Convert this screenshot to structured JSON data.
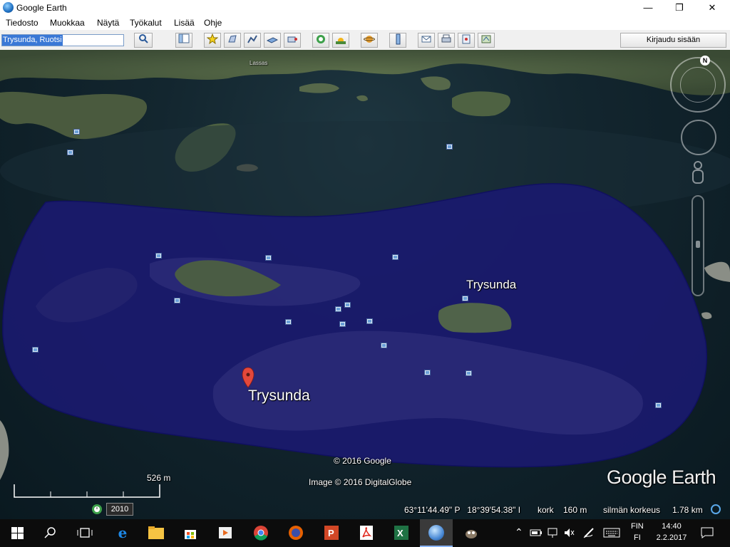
{
  "window": {
    "title": "Google Earth",
    "controls": [
      "—",
      "❐",
      "✕"
    ]
  },
  "menu": [
    "Tiedosto",
    "Muokkaa",
    "Näytä",
    "Työkalut",
    "Lisää",
    "Ohje"
  ],
  "toolbar": {
    "search_value": "Trysunda, Ruotsi",
    "login_label": "Kirjaudu sisään",
    "icons": [
      "search-icon",
      "sidebar-icon",
      "placemark-icon",
      "polygon-icon",
      "path-icon",
      "overlay-icon",
      "record-tour-icon",
      "historical-imagery-icon",
      "sunlight-icon",
      "planets-icon",
      "ruler-icon",
      "email-icon",
      "print-icon",
      "save-image-icon",
      "view-in-maps-icon"
    ]
  },
  "map": {
    "labels": {
      "top_place": "Lassas",
      "island_label": "Trysunda",
      "pin_label": "Trysunda",
      "copyright_google": "© 2016 Google",
      "copyright_image": "Image © 2016 DigitalGlobe",
      "logo": "Google Earth"
    },
    "compass_letter": "N",
    "scale": "526 m",
    "historical_year": "2010",
    "status": {
      "coords": "63°11'44.49\" P   18°39'54.38\" I",
      "elevation_label": "kork",
      "elevation_value": "160 m",
      "eye_label": "silmän korkeus",
      "eye_value": "1.78 km"
    },
    "colors": {
      "polygon_fill": "#1a1a6e",
      "polygon_stroke": "#101060",
      "pin": "#e3483b"
    }
  },
  "taskbar": {
    "apps": [
      "windows-start-icon",
      "search-icon",
      "task-view-icon",
      "edge-icon",
      "file-explorer-icon",
      "store-icon",
      "media-player-icon",
      "chrome-icon",
      "firefox-icon",
      "powerpoint-icon",
      "acrobat-icon",
      "excel-icon",
      "google-earth-icon",
      "gimp-icon"
    ],
    "lang_top": "FIN",
    "lang_bottom": "FI",
    "time": "14:40",
    "date": "2.2.2017"
  }
}
